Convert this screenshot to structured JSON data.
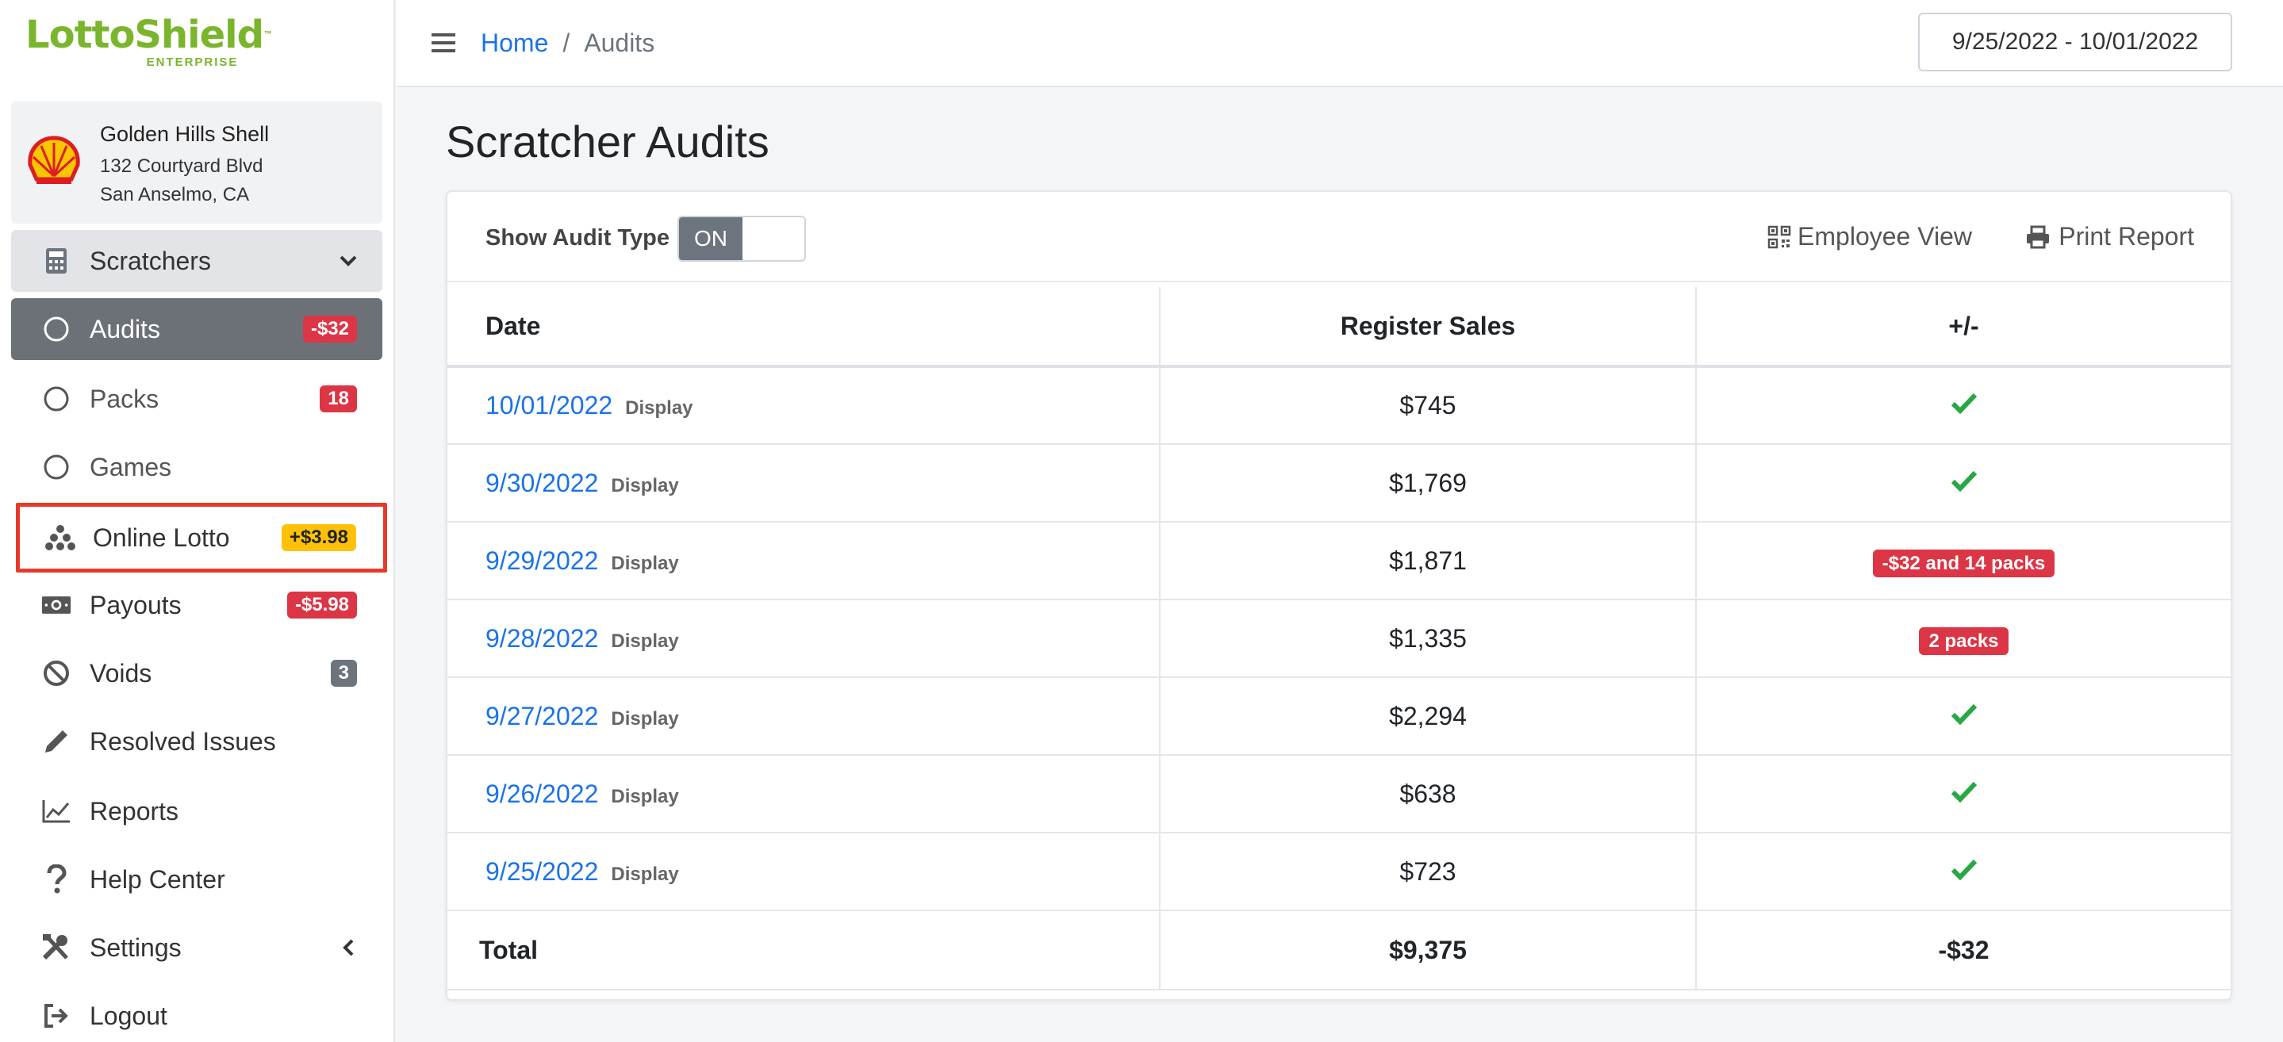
{
  "brand": {
    "name": "LottoShield",
    "tm": "™",
    "edition": "ENTERPRISE",
    "color": "#7ab52c"
  },
  "store": {
    "name": "Golden Hills Shell",
    "address_line1": "132 Courtyard Blvd",
    "address_line2": "San Anselmo, CA"
  },
  "sidebar": {
    "items": [
      {
        "label": "Scratchers",
        "icon": "calculator-icon"
      },
      {
        "label": "Audits",
        "badge": "-$32",
        "icon": "circle-icon"
      },
      {
        "label": "Packs",
        "badge": "18",
        "icon": "circle-icon"
      },
      {
        "label": "Games",
        "icon": "circle-icon"
      },
      {
        "label": "Online Lotto",
        "badge": "+$3.98",
        "icon": "balls-icon"
      },
      {
        "label": "Payouts",
        "badge": "-$5.98",
        "icon": "money-icon"
      },
      {
        "label": "Voids",
        "badge": "3",
        "icon": "ban-icon"
      },
      {
        "label": "Resolved Issues",
        "icon": "pencil-icon"
      },
      {
        "label": "Reports",
        "icon": "chart-line-icon"
      },
      {
        "label": "Help Center",
        "icon": "question-icon"
      },
      {
        "label": "Settings",
        "icon": "tools-icon"
      },
      {
        "label": "Logout",
        "icon": "logout-icon"
      }
    ]
  },
  "header": {
    "breadcrumb": {
      "home": "Home",
      "separator": "/",
      "current": "Audits"
    },
    "date_range": "9/25/2022 - 10/01/2022"
  },
  "main": {
    "title": "Scratcher Audits",
    "show_audit_type_label": "Show Audit Type",
    "toggle_state": "ON",
    "employee_view": "Employee View",
    "print_report": "Print Report",
    "table": {
      "headers": {
        "date": "Date",
        "sales": "Register Sales",
        "diff": "+/-"
      },
      "display_label": "Display",
      "rows": [
        {
          "date": "10/01/2022",
          "sales": "$745",
          "diff": "check"
        },
        {
          "date": "9/30/2022",
          "sales": "$1,769",
          "diff": "check"
        },
        {
          "date": "9/29/2022",
          "sales": "$1,871",
          "diff_badge": "-$32 and 14 packs"
        },
        {
          "date": "9/28/2022",
          "sales": "$1,335",
          "diff_badge": "2 packs"
        },
        {
          "date": "9/27/2022",
          "sales": "$2,294",
          "diff": "check"
        },
        {
          "date": "9/26/2022",
          "sales": "$638",
          "diff": "check"
        },
        {
          "date": "9/25/2022",
          "sales": "$723",
          "diff": "check"
        }
      ],
      "total": {
        "label": "Total",
        "sales": "$9,375",
        "diff": "-$32"
      }
    }
  },
  "colors": {
    "link": "#1a73e8",
    "danger": "#dc3545",
    "warning": "#ffc107",
    "success": "#28a745",
    "highlight": "#e53a2b"
  }
}
